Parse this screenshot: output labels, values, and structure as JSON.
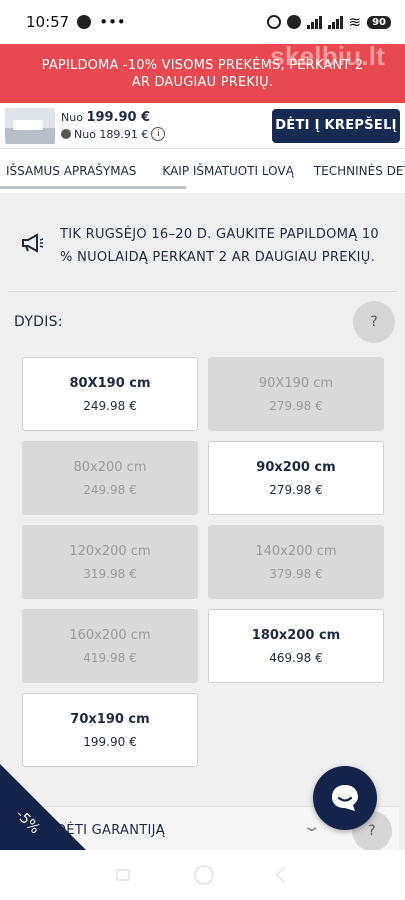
{
  "status_bar": {
    "time": "10:57",
    "battery": "90"
  },
  "promo_banner": {
    "text": "PAPILDOMA -10% VISOMS PREKĖMS, PERKANT 2 AR DAUGIAU PREKIŲ.",
    "watermark": "skelbiu.lt"
  },
  "buy_bar": {
    "from_label": "Nuo",
    "price": "199.90 €",
    "secondary_price": "Nuo 189.91 €",
    "info_symbol": "i",
    "cart_button": "DĖTI Į KREPŠELĮ"
  },
  "tabs": [
    "IŠSAMUS APRAŠYMAS",
    "KAIP IŠMATUOTI LOVĄ",
    "TECHNINĖS DETA"
  ],
  "notice": {
    "text": "TIK RUGSĖJO 16–20 D. GAUKITE PAPILDOMĄ 10 % NUOLAIDĄ PERKANT 2 AR DAUGIAU PREKIŲ."
  },
  "size_section": {
    "label": "DYDIS:",
    "help": "?",
    "options": [
      {
        "size": "80X190 cm",
        "price": "249.98 €",
        "available": true
      },
      {
        "size": "90X190 cm",
        "price": "279.98 €",
        "available": false
      },
      {
        "size": "80x200 cm",
        "price": "249.98 €",
        "available": false
      },
      {
        "size": "90x200 cm",
        "price": "279.98 €",
        "available": true
      },
      {
        "size": "120x200 cm",
        "price": "319.98 €",
        "available": false
      },
      {
        "size": "140x200 cm",
        "price": "379.98 €",
        "available": false
      },
      {
        "size": "160x200 cm",
        "price": "419.98 €",
        "available": false
      },
      {
        "size": "180x200 cm",
        "price": "469.98 €",
        "available": true
      },
      {
        "size": "70x190 cm",
        "price": "199.90 €",
        "available": true
      }
    ]
  },
  "guarantee": {
    "label": "DĖTI GARANTIJĄ",
    "help": "?"
  },
  "discount_badge": "-5%",
  "colors": {
    "primary": "#162a52",
    "banner": "#e8484f"
  }
}
